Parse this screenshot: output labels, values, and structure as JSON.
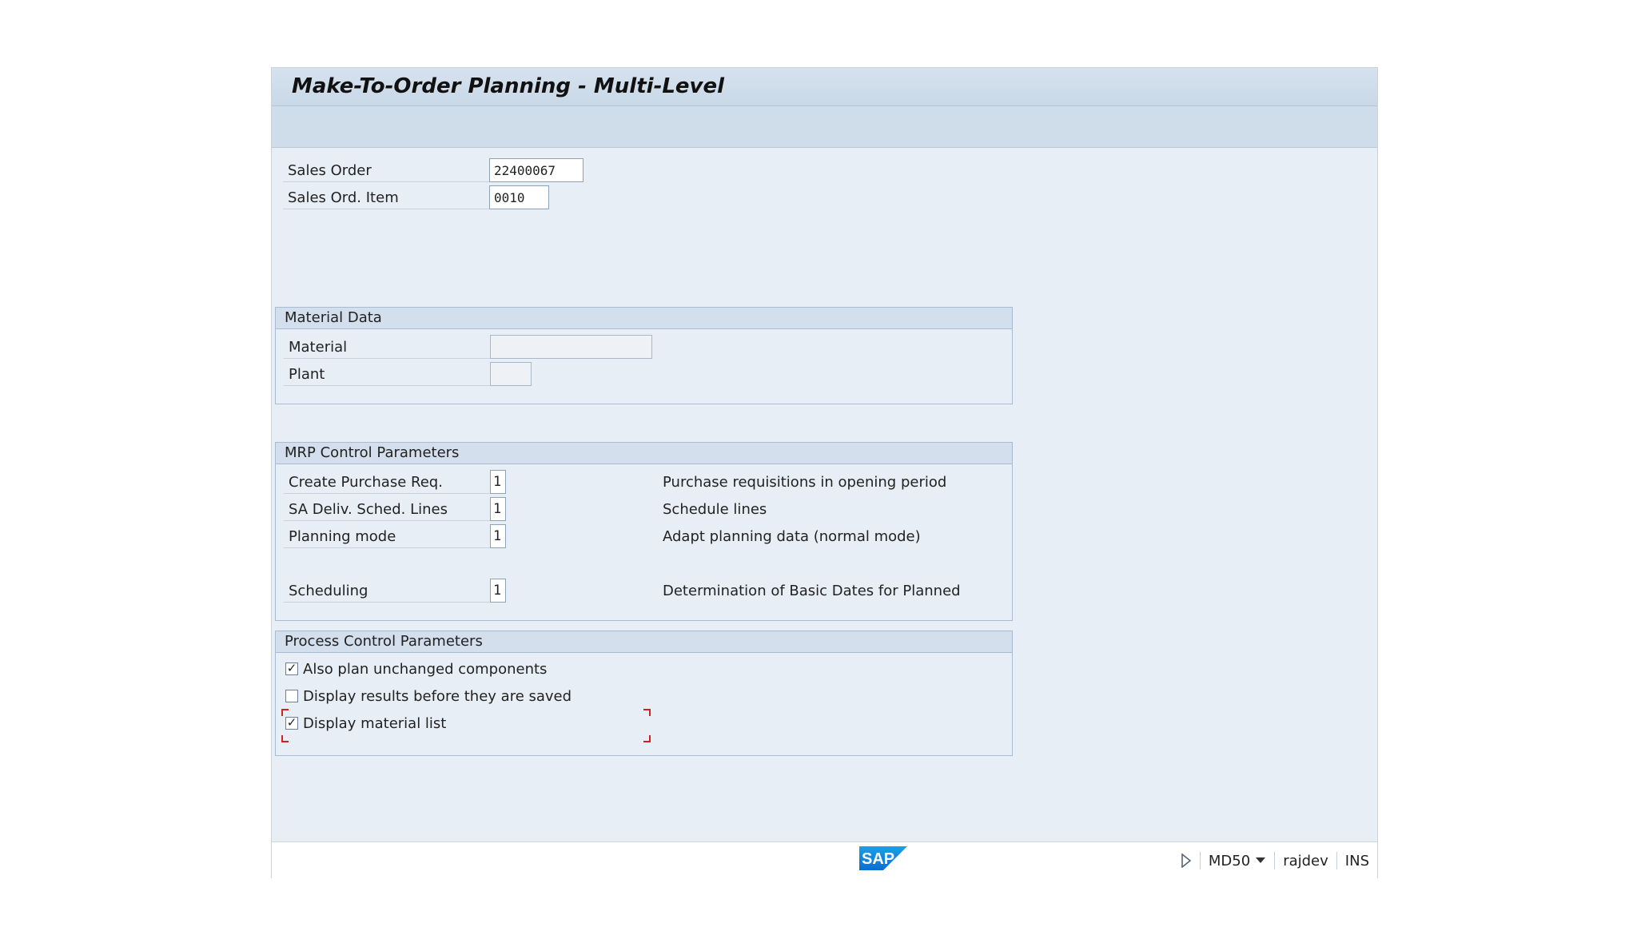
{
  "window": {
    "title": "Make-To-Order Planning - Multi-Level"
  },
  "sales": {
    "order_label": "Sales Order",
    "order_value": "22400067",
    "item_label": "Sales Ord. Item",
    "item_value": "0010"
  },
  "material_data": {
    "header": "Material Data",
    "material_label": "Material",
    "material_value": "",
    "plant_label": "Plant",
    "plant_value": ""
  },
  "mrp": {
    "header": "MRP Control Parameters",
    "rows": [
      {
        "label": "Create Purchase Req.",
        "value": "1",
        "desc": "Purchase requisitions in opening period"
      },
      {
        "label": "SA Deliv. Sched. Lines",
        "value": "1",
        "desc": "Schedule lines"
      },
      {
        "label": "Planning mode",
        "value": "1",
        "desc": "Adapt planning data (normal mode)"
      },
      {
        "label": "Scheduling",
        "value": "1",
        "desc": "Determination of Basic Dates for Planned"
      }
    ]
  },
  "process": {
    "header": "Process Control Parameters",
    "options": [
      {
        "label": "Also plan unchanged components",
        "checked": true,
        "mark": "✓"
      },
      {
        "label": "Display results before they are saved",
        "checked": false,
        "mark": ""
      },
      {
        "label": "Display material list",
        "checked": true,
        "mark": "✓"
      }
    ]
  },
  "status": {
    "logo": "SAP",
    "play_icon": "play-triangle-icon",
    "transaction": "MD50",
    "user": "rajdev",
    "mode": "INS"
  },
  "colors": {
    "accent": "#0a6ed1",
    "focus_bracket": "#d62020"
  }
}
